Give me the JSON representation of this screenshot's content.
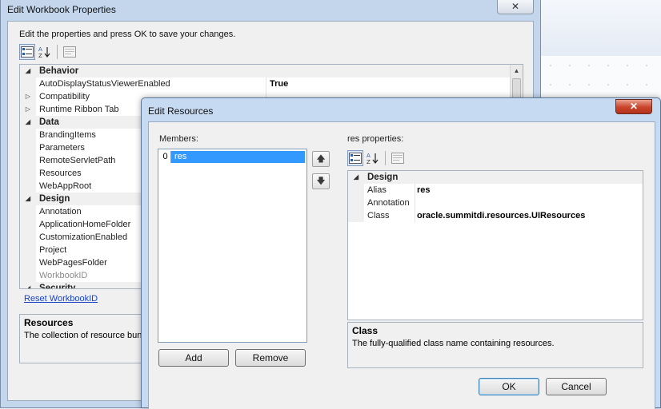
{
  "outer": {
    "title": "Edit Workbook Properties",
    "close": "✕",
    "instructions": "Edit the properties and press OK to save your changes.",
    "rows": [
      {
        "kind": "category",
        "name": "Behavior",
        "expanded": true
      },
      {
        "kind": "prop",
        "name": "AutoDisplayStatusViewerEnabled",
        "value": "True"
      },
      {
        "kind": "prop",
        "name": "Compatibility",
        "value": "",
        "expandable": true
      },
      {
        "kind": "prop",
        "name": "Runtime Ribbon Tab",
        "value": "",
        "expandable": true
      },
      {
        "kind": "category",
        "name": "Data",
        "expanded": true
      },
      {
        "kind": "prop",
        "name": "BrandingItems",
        "value": ""
      },
      {
        "kind": "prop",
        "name": "Parameters",
        "value": ""
      },
      {
        "kind": "prop",
        "name": "RemoteServletPath",
        "value": ""
      },
      {
        "kind": "prop",
        "name": "Resources",
        "value": ""
      },
      {
        "kind": "prop",
        "name": "WebAppRoot",
        "value": ""
      },
      {
        "kind": "category",
        "name": "Design",
        "expanded": true
      },
      {
        "kind": "prop",
        "name": "Annotation",
        "value": ""
      },
      {
        "kind": "prop",
        "name": "ApplicationHomeFolder",
        "value": ""
      },
      {
        "kind": "prop",
        "name": "CustomizationEnabled",
        "value": ""
      },
      {
        "kind": "prop",
        "name": "Project",
        "value": ""
      },
      {
        "kind": "prop",
        "name": "WebPagesFolder",
        "value": ""
      },
      {
        "kind": "prop",
        "name": "WorkbookID",
        "value": "",
        "disabled": true
      },
      {
        "kind": "category",
        "name": "Security",
        "expanded": true
      }
    ],
    "reset_link": "Reset WorkbookID",
    "desc_title": "Resources",
    "desc_text": "The collection of resource bund"
  },
  "inner": {
    "title": "Edit Resources",
    "close": "✕",
    "members_label": "Members:",
    "members": [
      {
        "index": "0",
        "name": "res"
      }
    ],
    "move_up": "🡅",
    "move_down": "🡇",
    "add": "Add",
    "remove": "Remove",
    "props_label": "res properties:",
    "category": "Design",
    "rows": [
      {
        "name": "Alias",
        "value": "res"
      },
      {
        "name": "Annotation",
        "value": ""
      },
      {
        "name": "Class",
        "value": "oracle.summitdi.resources.UIResources"
      }
    ],
    "desc_title": "Class",
    "desc_text": "The fully-qualified class name containing resources.",
    "ok": "OK",
    "cancel": "Cancel"
  },
  "icons": {
    "categorized": "categorized-icon",
    "alphabetical": "sort-az-icon",
    "property_pages": "property-pages-icon"
  }
}
